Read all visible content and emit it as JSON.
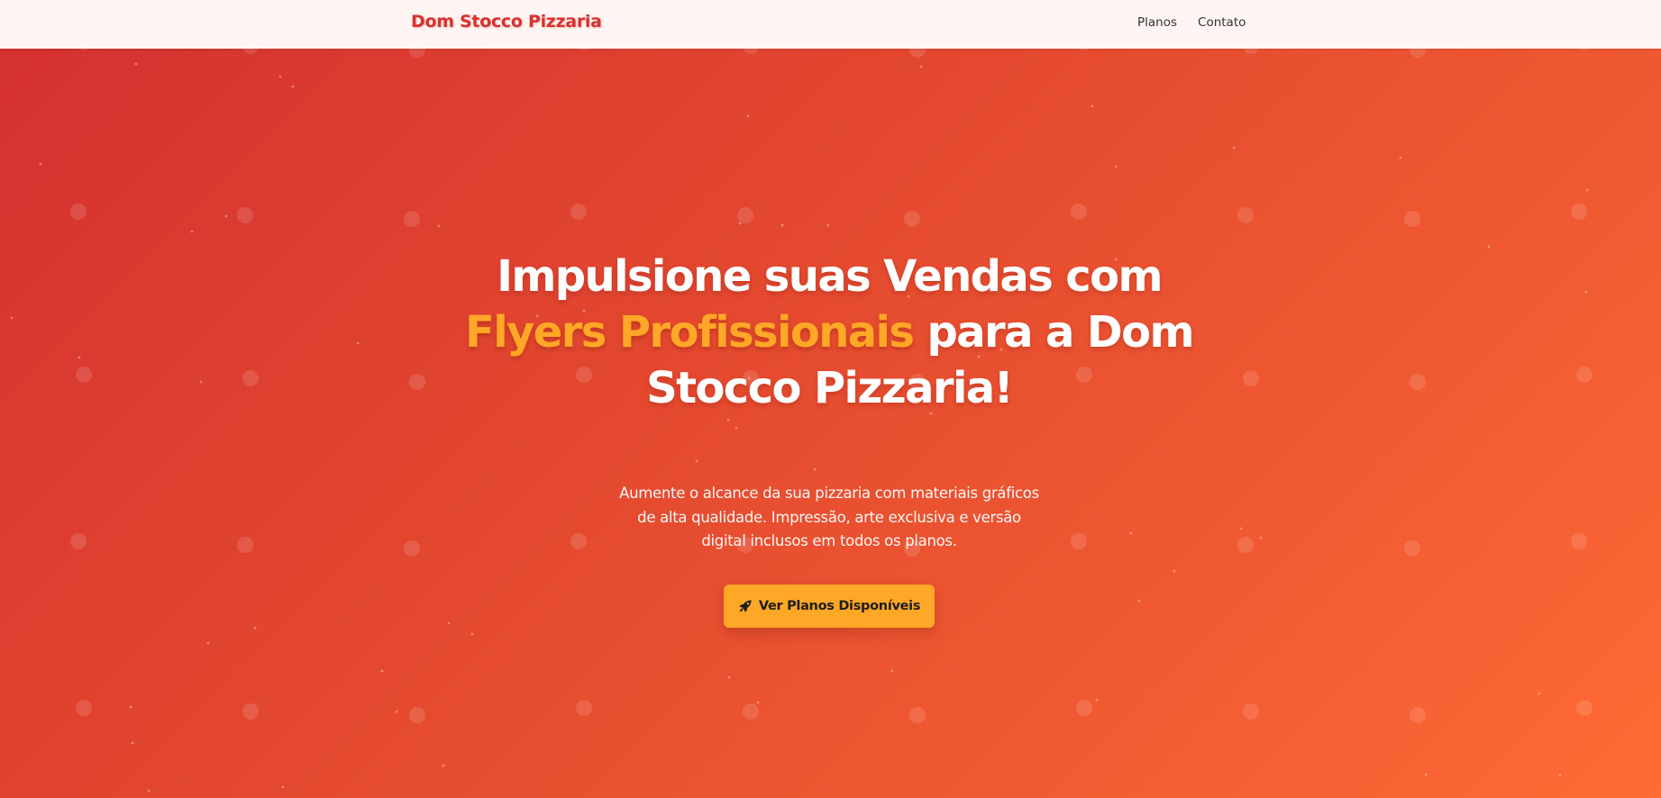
{
  "header": {
    "brand": "Dom Stocco Pizzaria",
    "nav": [
      {
        "label": "Planos"
      },
      {
        "label": "Contato"
      }
    ]
  },
  "hero": {
    "title_part1": "Impulsione suas Vendas com ",
    "title_highlight": "Flyers Profissionais",
    "title_part2": " para a Dom Stocco Pizzaria!",
    "subtitle": "Aumente o alcance da sua pizzaria com materiais gráficos de alta qualidade. Impressão, arte exclusiva e versão digital inclusos em todos os planos.",
    "cta_label": "Ver Planos Disponíveis",
    "cta_icon": "rocket-icon"
  },
  "colors": {
    "brand": "#d93030",
    "accent": "#ffa726",
    "gradient_start": "#d43131",
    "gradient_end": "#ff6a35",
    "navbar_bg": "#fff6f3"
  }
}
